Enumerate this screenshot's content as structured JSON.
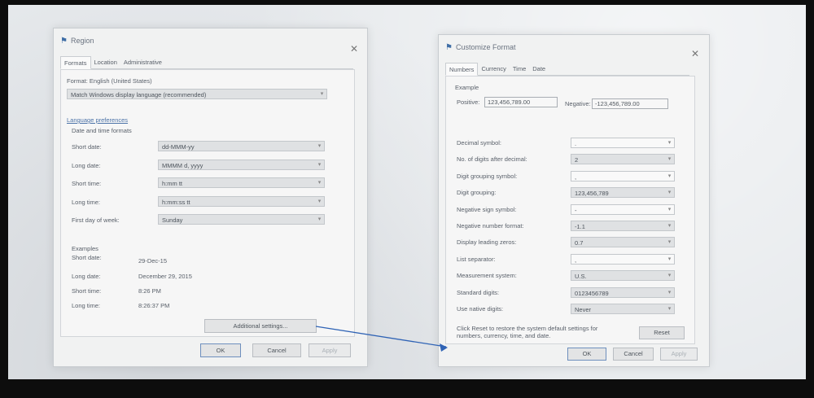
{
  "region": {
    "title": "Region",
    "tabs": [
      "Formats",
      "Location",
      "Administrative"
    ],
    "format_label": "Format: English (United States)",
    "format_value": "Match Windows display language (recommended)",
    "language_prefs_link": "Language preferences",
    "date_time_heading": "Date and time formats",
    "rows": [
      {
        "label": "Short date:",
        "value": "dd-MMM-yy"
      },
      {
        "label": "Long date:",
        "value": "MMMM d, yyyy"
      },
      {
        "label": "Short time:",
        "value": "h:mm tt"
      },
      {
        "label": "Long time:",
        "value": "h:mm:ss tt"
      },
      {
        "label": "First day of week:",
        "value": "Sunday"
      }
    ],
    "examples_heading": "Examples",
    "examples": [
      {
        "label": "Short date:",
        "value": "29-Dec-15"
      },
      {
        "label": "Long date:",
        "value": "December 29, 2015"
      },
      {
        "label": "Short time:",
        "value": "8:26 PM"
      },
      {
        "label": "Long time:",
        "value": "8:26:37 PM"
      }
    ],
    "additional_settings": "Additional settings...",
    "ok": "OK",
    "cancel": "Cancel",
    "apply": "Apply"
  },
  "customize": {
    "title": "Customize Format",
    "tabs": [
      "Numbers",
      "Currency",
      "Time",
      "Date"
    ],
    "example_heading": "Example",
    "positive_label": "Positive:",
    "positive_value": "123,456,789.00",
    "negative_label": "Negative:",
    "negative_value": "-123,456,789.00",
    "rows": [
      {
        "label": "Decimal symbol:",
        "value": "."
      },
      {
        "label": "No. of digits after decimal:",
        "value": "2"
      },
      {
        "label": "Digit grouping symbol:",
        "value": ","
      },
      {
        "label": "Digit grouping:",
        "value": "123,456,789"
      },
      {
        "label": "Negative sign symbol:",
        "value": "-"
      },
      {
        "label": "Negative number format:",
        "value": "-1.1"
      },
      {
        "label": "Display leading zeros:",
        "value": "0.7"
      },
      {
        "label": "List separator:",
        "value": ","
      },
      {
        "label": "Measurement system:",
        "value": "U.S."
      },
      {
        "label": "Standard digits:",
        "value": "0123456789"
      },
      {
        "label": "Use native digits:",
        "value": "Never"
      }
    ],
    "reset_note": "Click Reset to restore the system default settings for numbers, currency, time, and date.",
    "reset": "Reset",
    "ok": "OK",
    "cancel": "Cancel",
    "apply": "Apply"
  },
  "colors": {
    "annotation_arrow": "#2f63b5",
    "link": "#4c73a8"
  }
}
